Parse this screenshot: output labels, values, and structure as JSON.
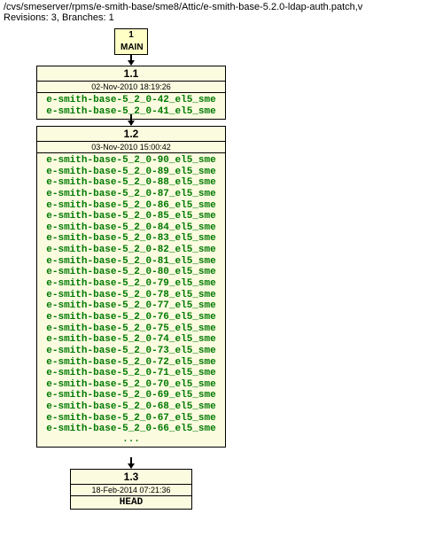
{
  "header": {
    "path": "/cvs/smeserver/rpms/e-smith-base/sme8/Attic/e-smith-base-5.2.0-ldap-auth.patch,v",
    "rev_line": "Revisions: 3, Branches: 1"
  },
  "branch": {
    "number": "1",
    "name": "MAIN"
  },
  "nodes": [
    {
      "rev": "1.1",
      "date": "02-Nov-2010 18:19:26",
      "tags": [
        "e-smith-base-5_2_0-42_el5_sme",
        "e-smith-base-5_2_0-41_el5_sme"
      ]
    },
    {
      "rev": "1.2",
      "date": "03-Nov-2010 15:00:42",
      "tags": [
        "e-smith-base-5_2_0-90_el5_sme",
        "e-smith-base-5_2_0-89_el5_sme",
        "e-smith-base-5_2_0-88_el5_sme",
        "e-smith-base-5_2_0-87_el5_sme",
        "e-smith-base-5_2_0-86_el5_sme",
        "e-smith-base-5_2_0-85_el5_sme",
        "e-smith-base-5_2_0-84_el5_sme",
        "e-smith-base-5_2_0-83_el5_sme",
        "e-smith-base-5_2_0-82_el5_sme",
        "e-smith-base-5_2_0-81_el5_sme",
        "e-smith-base-5_2_0-80_el5_sme",
        "e-smith-base-5_2_0-79_el5_sme",
        "e-smith-base-5_2_0-78_el5_sme",
        "e-smith-base-5_2_0-77_el5_sme",
        "e-smith-base-5_2_0-76_el5_sme",
        "e-smith-base-5_2_0-75_el5_sme",
        "e-smith-base-5_2_0-74_el5_sme",
        "e-smith-base-5_2_0-73_el5_sme",
        "e-smith-base-5_2_0-72_el5_sme",
        "e-smith-base-5_2_0-71_el5_sme",
        "e-smith-base-5_2_0-70_el5_sme",
        "e-smith-base-5_2_0-69_el5_sme",
        "e-smith-base-5_2_0-68_el5_sme",
        "e-smith-base-5_2_0-67_el5_sme",
        "e-smith-base-5_2_0-66_el5_sme"
      ],
      "truncated": "..."
    },
    {
      "rev": "1.3",
      "date": "18-Feb-2014 07:21:36",
      "head": "HEAD"
    }
  ]
}
